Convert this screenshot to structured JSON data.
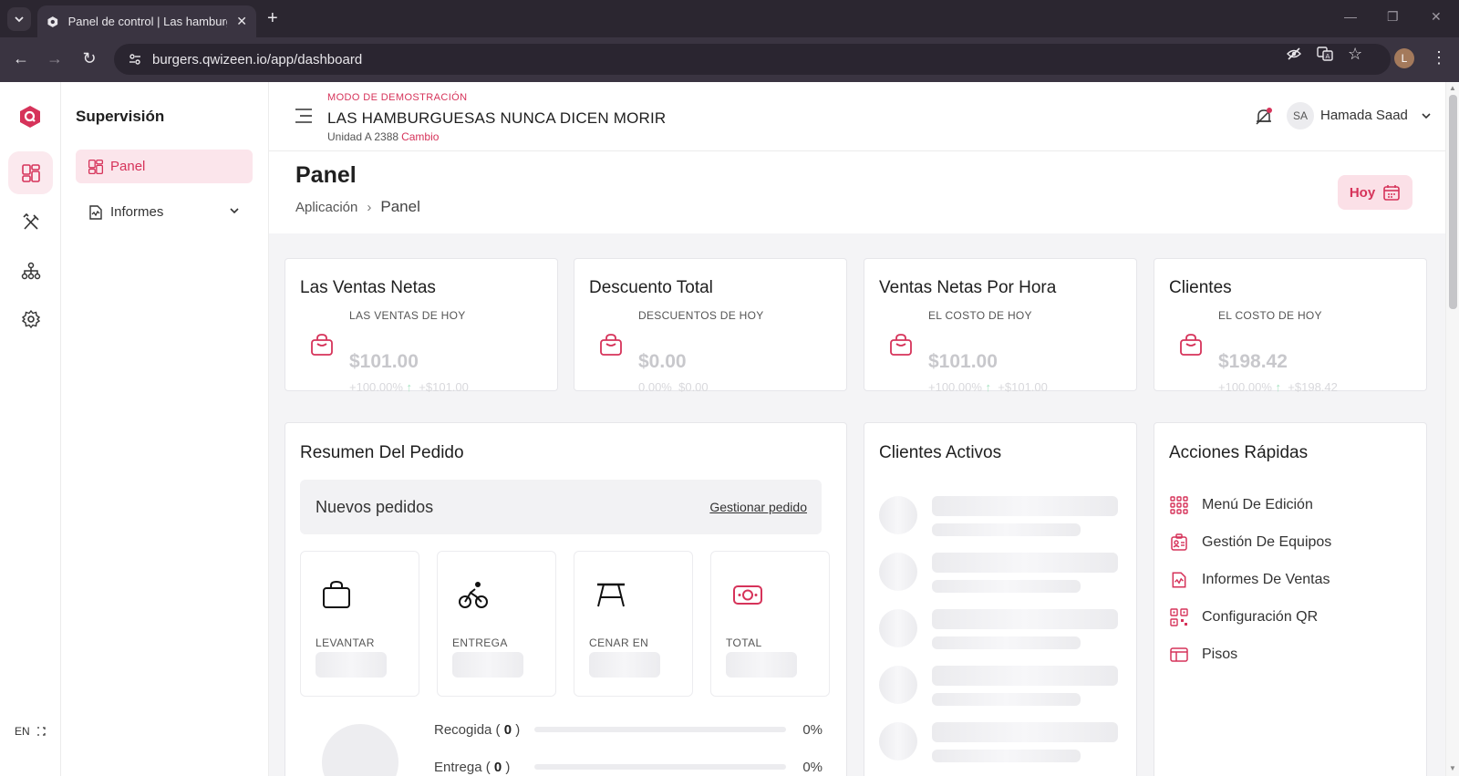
{
  "browser": {
    "tab_title": "Panel de control | Las hamburg",
    "url": "burgers.qwizeen.io/app/dashboard",
    "profile_initial": "L"
  },
  "rail": {
    "lang": "EN",
    "items": [
      "dashboard-icon",
      "utensils-icon",
      "org-chart-icon",
      "gear-icon"
    ]
  },
  "sidebar": {
    "title": "Supervisión",
    "items": [
      {
        "label": "Panel",
        "active": true
      },
      {
        "label": "Informes",
        "active": false
      }
    ]
  },
  "topbar": {
    "demo": "MODO DE DEMOSTRACIÓN",
    "brand": "LAS HAMBURGUESAS NUNCA DICEN MORIR",
    "unit": "Unidad A 2388",
    "change": "Cambio",
    "user_initials": "SA",
    "user_name": "Hamada Saad"
  },
  "page": {
    "title": "Panel",
    "breadcrumb": [
      "Aplicación",
      "Panel"
    ],
    "today_label": "Hoy"
  },
  "stats": [
    {
      "title": "Las Ventas Netas",
      "sub": "LAS VENTAS DE HOY",
      "value": "$101.00",
      "pct": "+100.00%",
      "arrow": "↑",
      "delta": "+$101.00"
    },
    {
      "title": "Descuento Total",
      "sub": "DESCUENTOS DE HOY",
      "value": "$0.00",
      "pct": "0.00%",
      "arrow": "",
      "delta": "$0.00"
    },
    {
      "title": "Ventas Netas Por Hora",
      "sub": "EL COSTO DE HOY",
      "value": "$101.00",
      "pct": "+100.00%",
      "arrow": "↑",
      "delta": "+$101.00"
    },
    {
      "title": "Clientes",
      "sub": "EL COSTO DE HOY",
      "value": "$198.42",
      "pct": "+100.00%",
      "arrow": "↑",
      "delta": "+$198.42"
    }
  ],
  "orders": {
    "title": "Resumen Del Pedido",
    "new_orders": "Nuevos pedidos",
    "manage": "Gestionar pedido",
    "tiles": [
      {
        "label": "LEVANTAR",
        "icon": "shopping-bag-icon"
      },
      {
        "label": "ENTREGA",
        "icon": "cyclist-icon"
      },
      {
        "label": "CENAR EN",
        "icon": "picnic-table-icon"
      },
      {
        "label": "TOTAL",
        "icon": "cash-icon"
      }
    ],
    "progress": [
      {
        "label": "Recogida",
        "count": "0",
        "pct_value": 0,
        "pct": "0%"
      },
      {
        "label": "Entrega",
        "count": "0",
        "pct_value": 0,
        "pct": "0%"
      }
    ]
  },
  "active_clients": {
    "title": "Clientes Activos"
  },
  "quick_actions": {
    "title": "Acciones Rápidas",
    "items": [
      {
        "label": "Menú De Edición",
        "icon": "grid-icon"
      },
      {
        "label": "Gestión De Equipos",
        "icon": "id-card-icon"
      },
      {
        "label": "Informes De Ventas",
        "icon": "report-icon"
      },
      {
        "label": "Configuración QR",
        "icon": "qr-icon"
      },
      {
        "label": "Pisos",
        "icon": "layout-icon"
      }
    ]
  },
  "colors": {
    "accent": "#d6335a",
    "accent_soft": "#fbe5eb"
  }
}
